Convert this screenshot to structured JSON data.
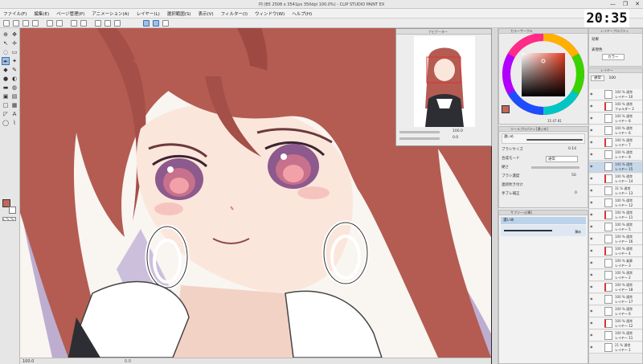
{
  "window": {
    "title": "円 (B5 2508 x 3541px 350dpi 100.0%) - CLIP STUDIO PAINT EX",
    "controls": [
      "—",
      "❐",
      "✕"
    ]
  },
  "clock": "20:35",
  "menu": [
    "ファイル(F)",
    "編集(E)",
    "ページ管理(P)",
    "アニメーション(A)",
    "レイヤー(L)",
    "選択範囲(S)",
    "表示(V)",
    "フィルター(I)",
    "ウィンドウ(W)",
    "ヘルプ(H)"
  ],
  "navigator": {
    "title": "ナビゲーター",
    "zoom": "100.0",
    "rotation": "0.0"
  },
  "color_wheel": {
    "title": "カラーサークル",
    "values": [
      "15",
      "47",
      "81"
    ],
    "main_color": "#c0675a"
  },
  "tool_property": {
    "title": "ツールプロパティ[濃いめ]",
    "brush_name": "濃いめ",
    "rows": [
      {
        "label": "ブラシサイズ",
        "value": "0.14"
      },
      {
        "label": "合成モード",
        "value": "通常"
      },
      {
        "label": "硬さ",
        "value": ""
      },
      {
        "label": "ブラシ濃度",
        "value": "50"
      },
      {
        "label": "連続吹き付け",
        "value": ""
      },
      {
        "label": "手ブレ補正",
        "value": "0"
      }
    ]
  },
  "sub_tool": {
    "title": "サブツール[筆]",
    "items": [
      "濃いめ",
      "薄め"
    ],
    "selected": "濃いめ"
  },
  "layer_property": {
    "title": "レイヤープロパティ",
    "effect_label": "効果",
    "expression_label": "表現色",
    "expression_value": "カラー"
  },
  "layers": {
    "title": "レイヤー",
    "blend": "通常",
    "opacity": "100",
    "rows": [
      {
        "blend": "100 % 通常",
        "name": "レイヤー 10"
      },
      {
        "blend": "100 % 通常",
        "name": "フォルダー 2"
      },
      {
        "blend": "100 % 通常",
        "name": "レイヤー 8"
      },
      {
        "blend": "100 % 通常",
        "name": "レイヤー 6"
      },
      {
        "blend": "100 % 通常",
        "name": "レイヤー 7"
      },
      {
        "blend": "100 % 通常",
        "name": "レイヤー 9"
      },
      {
        "blend": "100 % 通常",
        "name": "レイヤー 15",
        "selected": true
      },
      {
        "blend": "100 % 通常",
        "name": "レイヤー 14"
      },
      {
        "blend": "31 % 通常",
        "name": "レイヤー 13"
      },
      {
        "blend": "100 % 通常",
        "name": "レイヤー 12"
      },
      {
        "blend": "100 % 通常",
        "name": "レイヤー 11"
      },
      {
        "blend": "100 % 通常",
        "name": "レイヤー 5"
      },
      {
        "blend": "100 % 通常",
        "name": "レイヤー 16"
      },
      {
        "blend": "100 % 通常",
        "name": "レイヤー 4"
      },
      {
        "blend": "100 % 乗算",
        "name": "レイヤー 3"
      },
      {
        "blend": "100 % 通常",
        "name": "レイヤー 2"
      },
      {
        "blend": "100 % 通常",
        "name": "レイヤー 18"
      },
      {
        "blend": "100 % 通常",
        "name": "レイヤー 17"
      },
      {
        "blend": "100 % 通常",
        "name": "レイヤー 6"
      },
      {
        "blend": "100 % 通常",
        "name": "レイヤー 12"
      },
      {
        "blend": "100 % 通常",
        "name": "レイヤー 11"
      },
      {
        "blend": "21 % 通常",
        "name": "レイヤー 1"
      }
    ]
  },
  "status": {
    "zoom": "100.0",
    "coord": "0.0"
  },
  "colors": {
    "hair": "#b45c52",
    "skin": "#fbe6dc",
    "shadow": "#b9a6c9",
    "accent_blue": "#3a72b5"
  }
}
